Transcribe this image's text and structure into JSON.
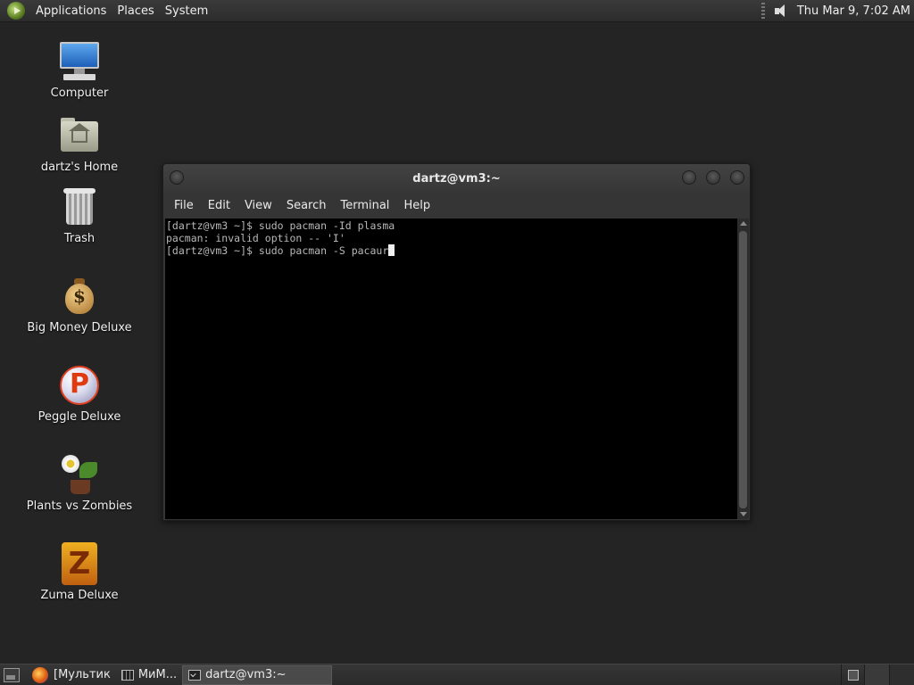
{
  "top_panel": {
    "menus": [
      "Applications",
      "Places",
      "System"
    ],
    "clock": "Thu Mar  9,  7:02 AM"
  },
  "desktop_icons": [
    {
      "label": "Computer",
      "icon": "computer-icon"
    },
    {
      "label": "dartz's Home",
      "icon": "home-folder-icon"
    },
    {
      "label": "Trash",
      "icon": "trash-icon"
    },
    {
      "label": "Big Money Deluxe",
      "icon": "money-bag-icon"
    },
    {
      "label": "Peggle Deluxe",
      "icon": "peggle-icon"
    },
    {
      "label": "Plants vs Zombies",
      "icon": "plants-vs-zombies-icon"
    },
    {
      "label": "Zuma Deluxe",
      "icon": "zuma-icon"
    }
  ],
  "terminal": {
    "title": "dartz@vm3:~",
    "menu": [
      "File",
      "Edit",
      "View",
      "Search",
      "Terminal",
      "Help"
    ],
    "lines": [
      "[dartz@vm3 ~]$ sudo pacman -Id plasma",
      "pacman: invalid option -- 'I'",
      "[dartz@vm3 ~]$ sudo pacman -S pacaur"
    ]
  },
  "bottom_panel": {
    "tasks": [
      {
        "label": "[Мультик",
        "icon": "firefox-icon"
      },
      {
        "label": "МиМ...",
        "icon": "window-icon"
      },
      {
        "label": "dartz@vm3:~",
        "icon": "terminal-icon",
        "active": true
      }
    ]
  }
}
